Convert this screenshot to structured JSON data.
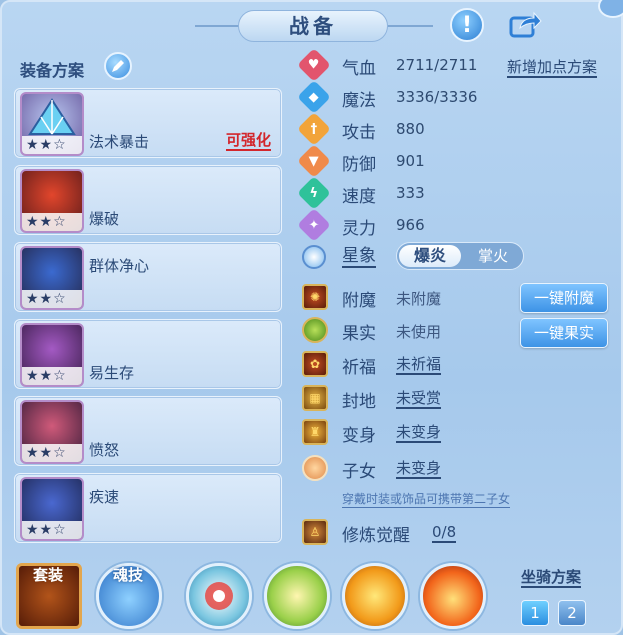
{
  "header": {
    "title": "战备"
  },
  "left": {
    "title": "装备方案",
    "items": [
      {
        "name": "法术暴击",
        "stars": "★★☆",
        "enhance": "可强化"
      },
      {
        "name": "爆破",
        "stars": "★★☆"
      },
      {
        "name": "群体净心",
        "stars": "★★☆"
      },
      {
        "name": "易生存",
        "stars": "★★☆"
      },
      {
        "name": "愤怒",
        "stars": "★★☆"
      },
      {
        "name": "疾速",
        "stars": "★★☆"
      }
    ]
  },
  "stats": {
    "hp": {
      "label": "气血",
      "value": "2711/2711",
      "icon": "heart-icon",
      "color": "#e2556d"
    },
    "mp": {
      "label": "魔法",
      "value": "3336/3336",
      "icon": "mana-icon",
      "color": "#3aa3ea"
    },
    "atk": {
      "label": "攻击",
      "value": "880",
      "icon": "sword-icon",
      "color": "#f2a43a"
    },
    "def": {
      "label": "防御",
      "value": "901",
      "icon": "shield-icon",
      "color": "#f08a4a"
    },
    "spd": {
      "label": "速度",
      "value": "333",
      "icon": "speed-icon",
      "color": "#2fc29a"
    },
    "spirit": {
      "label": "灵力",
      "value": "966",
      "icon": "spirit-icon",
      "color": "#b07de0"
    },
    "new_plan": "新增加点方案"
  },
  "star": {
    "label": "星象",
    "option_on": "爆炎",
    "option_off": "掌火"
  },
  "extras": {
    "enchant": {
      "label": "附魔",
      "value": "未附魔",
      "button": "一键附魔"
    },
    "fruit": {
      "label": "果实",
      "value": "未使用",
      "button": "一键果实"
    },
    "bless": {
      "label": "祈福",
      "value": "未祈福"
    },
    "land": {
      "label": "封地",
      "value": "未受赏"
    },
    "transform": {
      "label": "变身",
      "value": "未变身"
    },
    "child": {
      "label": "子女",
      "value": "未变身"
    },
    "hint": "穿戴时装或饰品可携带第二子女",
    "cultivate": {
      "label": "修炼觉醒",
      "value": "0/8"
    }
  },
  "bottom": {
    "suit": "套装",
    "soul": "魂技",
    "mount_title": "坐骑方案",
    "mount_1": "1",
    "mount_2": "2"
  }
}
